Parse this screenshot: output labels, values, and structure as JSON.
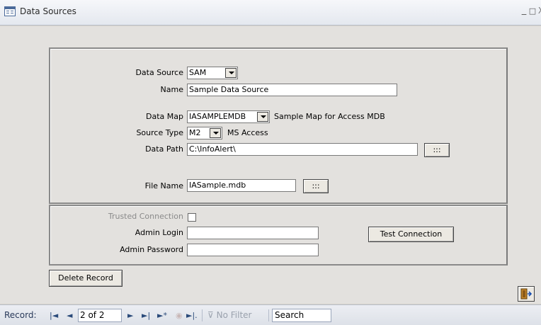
{
  "window": {
    "title": "Data Sources",
    "controls": {
      "minimize": "_",
      "restore": "□",
      "close": "X"
    }
  },
  "form": {
    "data_source": {
      "label": "Data Source",
      "value": "SAM"
    },
    "name": {
      "label": "Name",
      "value": "Sample Data Source"
    },
    "data_map": {
      "label": "Data Map",
      "value": "IASAMPLEMDB",
      "description": "Sample Map for Access MDB"
    },
    "source_type": {
      "label": "Source Type",
      "value": "M2",
      "description": "MS Access"
    },
    "data_path": {
      "label": "Data Path",
      "value": "C:\\InfoAlert\\",
      "browse": ":::"
    },
    "file_name": {
      "label": "File Name",
      "value": "IASample.mdb",
      "browse": ":::"
    },
    "trusted_connection": {
      "label": "Trusted Connection",
      "checked": false
    },
    "admin_login": {
      "label": "Admin Login",
      "value": ""
    },
    "admin_password": {
      "label": "Admin Password",
      "value": ""
    },
    "test_connection_button": "Test Connection",
    "delete_record_button": "Delete Record"
  },
  "navigation": {
    "record_label": "Record:",
    "first": "|◄",
    "previous": "◄",
    "record_position": "2 of 2",
    "next": "►",
    "last": "►|",
    "new": "►*",
    "filter_status": "No Filter",
    "search_placeholder": "Search"
  },
  "colors": {
    "background": "#e3e1de",
    "title_bar": "#e4e8ef",
    "nav_text": "#2a4a7a"
  }
}
